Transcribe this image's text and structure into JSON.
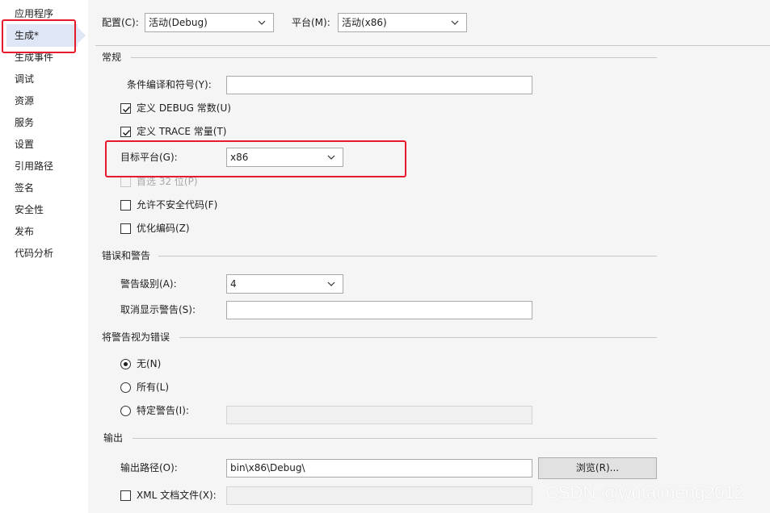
{
  "sidebar": {
    "items": [
      {
        "label": "应用程序"
      },
      {
        "label": "生成*"
      },
      {
        "label": "生成事件"
      },
      {
        "label": "调试"
      },
      {
        "label": "资源"
      },
      {
        "label": "服务"
      },
      {
        "label": "设置"
      },
      {
        "label": "引用路径"
      },
      {
        "label": "签名"
      },
      {
        "label": "安全性"
      },
      {
        "label": "发布"
      },
      {
        "label": "代码分析"
      }
    ],
    "selected_index": 1
  },
  "toolbar": {
    "config_label": "配置(C):",
    "config_value": "活动(Debug)",
    "platform_label": "平台(M):",
    "platform_value": "活动(x86)"
  },
  "general": {
    "title": "常规",
    "conditional_symbols_label": "条件编译和符号(Y):",
    "conditional_symbols_value": "",
    "define_debug_label": "定义 DEBUG 常数(U)",
    "define_debug_checked": true,
    "define_trace_label": "定义 TRACE 常量(T)",
    "define_trace_checked": true,
    "target_platform_label": "目标平台(G):",
    "target_platform_value": "x86",
    "prefer32_label": "首选 32 位(P)",
    "prefer32_enabled": false,
    "allow_unsafe_label": "允许不安全代码(F)",
    "allow_unsafe_checked": false,
    "optimize_label": "优化编码(Z)",
    "optimize_checked": false
  },
  "errors": {
    "title": "错误和警告",
    "warning_level_label": "警告级别(A):",
    "warning_level_value": "4",
    "suppress_label": "取消显示警告(S):",
    "suppress_value": ""
  },
  "treat_warnings": {
    "title": "将警告视为错误",
    "none_label": "无(N)",
    "all_label": "所有(L)",
    "specific_label": "特定警告(I):",
    "selected": "none",
    "specific_value": ""
  },
  "output": {
    "title": "输出",
    "path_label": "输出路径(O):",
    "path_value": "bin\\x86\\Debug\\",
    "browse_label": "浏览(R)...",
    "xml_doc_label": "XML 文档文件(X):",
    "xml_doc_checked": false,
    "xml_doc_value": ""
  },
  "watermark": "CSDN @wutaimeng2012",
  "colors": {
    "highlight_red": "#e8192c",
    "selected_nav_bg": "#dfe6f6"
  }
}
